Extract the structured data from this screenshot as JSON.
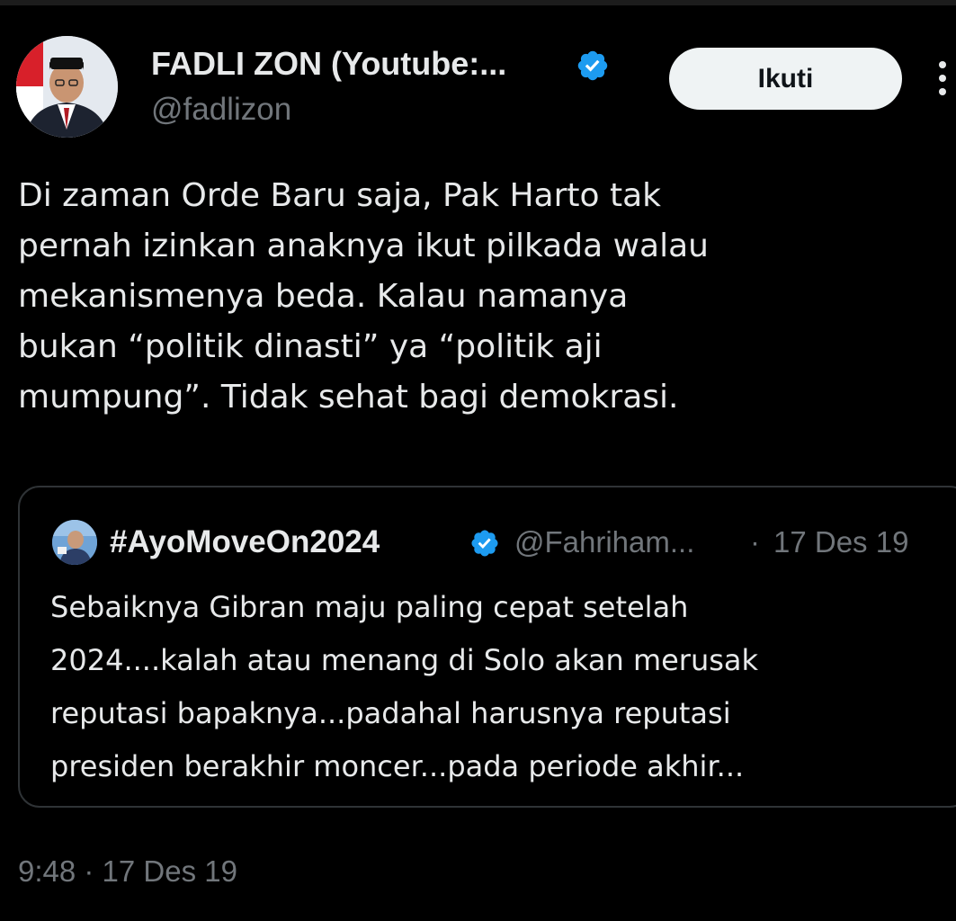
{
  "author": {
    "display_name": "FADLI ZON (Youtube:...",
    "handle": "@fadlizon",
    "avatar_icon": "user-avatar-icon"
  },
  "follow_button": {
    "label": "Ikuti"
  },
  "more_options_icon": "more-vertical-icon",
  "tweet": {
    "text_lines": [
      "Di zaman Orde Baru saja, Pak Harto tak",
      "pernah izinkan anaknya ikut pilkada walau",
      "mekanismenya beda.  Kalau namanya",
      "bukan “politik dinasti” ya “politik aji",
      "mumpung”. Tidak sehat bagi demokrasi."
    ],
    "timestamp": "9:48 · 17 Des 19"
  },
  "quoted_tweet": {
    "display_name": "#AyoMoveOn2024",
    "handle": "@Fahriham...",
    "separator": "·",
    "date": "17 Des 19",
    "text_lines": [
      "Sebaiknya Gibran maju paling cepat setelah",
      "2024....kalah atau menang di Solo akan merusak",
      "reputasi bapaknya...padahal harusnya reputasi",
      "presiden berakhir moncer...pada periode akhir..."
    ]
  },
  "colors": {
    "background": "#000000",
    "text_primary": "#e7e9ea",
    "text_secondary": "#71767b",
    "verified_blue": "#1d9bf0",
    "button_bg": "#eff3f4",
    "card_border": "#2f3336"
  }
}
